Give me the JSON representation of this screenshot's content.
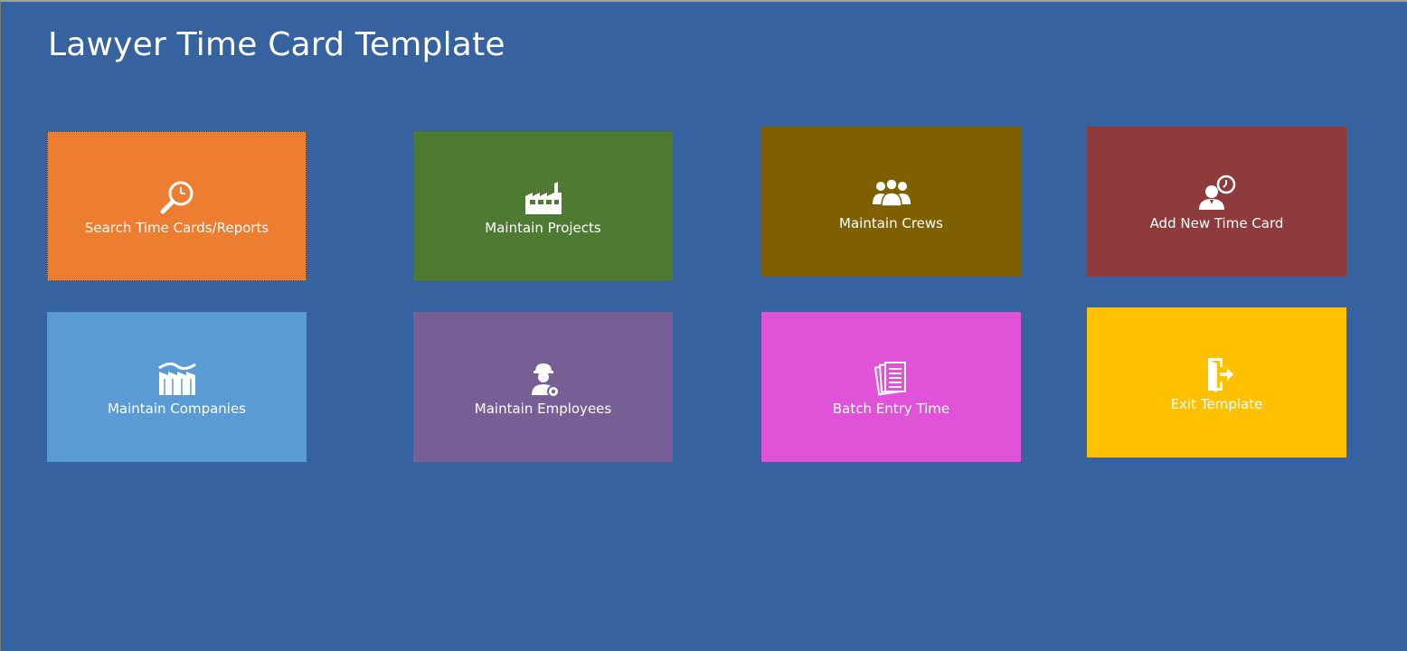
{
  "app": {
    "title": "Lawyer Time Card Template"
  },
  "tiles": [
    {
      "label": "Search Time Cards/Reports",
      "icon": "magnifier-clock-icon",
      "color": "#ed7d31"
    },
    {
      "label": "Maintain Projects",
      "icon": "factory-icon",
      "color": "#4e7a33"
    },
    {
      "label": "Maintain Crews",
      "icon": "people-group-icon",
      "color": "#7f6000"
    },
    {
      "label": "Add New Time Card",
      "icon": "person-clock-icon",
      "color": "#8e3b3b"
    },
    {
      "label": "Maintain Companies",
      "icon": "company-buildings-icon",
      "color": "#5b9bd5"
    },
    {
      "label": "Maintain Employees",
      "icon": "worker-gear-icon",
      "color": "#775f95"
    },
    {
      "label": "Batch Entry Time",
      "icon": "stacked-documents-icon",
      "color": "#e052d8"
    },
    {
      "label": "Exit Template",
      "icon": "exit-door-icon",
      "color": "#ffc000"
    }
  ],
  "colors": {
    "background": "#36629f",
    "text": "#ffffff"
  }
}
